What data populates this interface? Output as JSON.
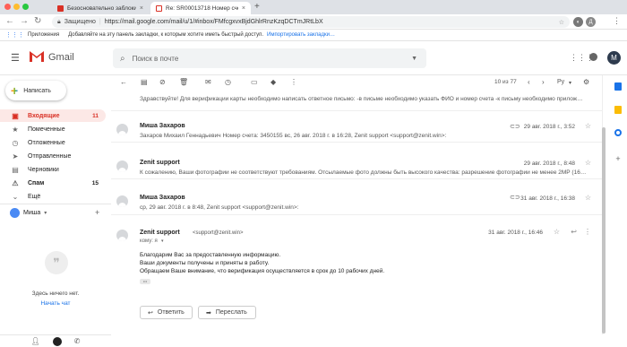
{
  "browser": {
    "tabs": [
      {
        "title": "Безосновательно заблокиров…",
        "close": "×"
      },
      {
        "title": "Re: SR00013718 Номер счета…",
        "close": "×"
      }
    ],
    "new_tab": "+",
    "secure_label": "Защищено",
    "url": "https://mail.google.com/mail/u/1/#inbox/FMfcgxvxBjdGhlrRnzKzqDCTmJRtLbX",
    "bookmarks": {
      "apps_label": "Приложения",
      "hint": "Добавляйте на эту панель закладки, к которым хотите иметь быстрый доступ.",
      "import_link": "Импортировать закладки…"
    },
    "profile_letter": "Д"
  },
  "gmail": {
    "logo_text": "Gmail",
    "search_placeholder": "Поиск в почте",
    "avatar_letter": "M"
  },
  "sidebar": {
    "compose_label": "Написать",
    "items": [
      {
        "label": "Входящие",
        "count": "11",
        "icon": "inbox-icon"
      },
      {
        "label": "Помеченные",
        "count": "",
        "icon": "star-icon"
      },
      {
        "label": "Отложенные",
        "count": "",
        "icon": "clock-icon"
      },
      {
        "label": "Отправленные",
        "count": "",
        "icon": "send-icon"
      },
      {
        "label": "Черновики",
        "count": "",
        "icon": "draft-icon"
      },
      {
        "label": "Спам",
        "count": "15",
        "icon": "spam-icon"
      },
      {
        "label": "Ещё",
        "count": "",
        "icon": "chevron-down-icon"
      }
    ],
    "hangouts_user": "Миша",
    "no_chats": "Здесь ничего нет.",
    "start_chat": "Начать чат"
  },
  "toolbar": {
    "page_info": "10 из 77",
    "lang": "Ру"
  },
  "messages": [
    {
      "sender": "",
      "snippet": "Здравствуйте! Для верификации карты необходимо написать ответное письмо: -в письме необходимо указать ФИО и номер счета -к письму необходимо прилож…",
      "date": ""
    },
    {
      "sender": "Миша Захаров",
      "snippet": "Захаров Михаил Геннадьевич Номер счета: 3450155 вс, 26 авг. 2018 г. в 16:28, Zenit support <support@zenit.win>:",
      "date": "29 авг. 2018 г., 3:52"
    },
    {
      "sender": "Zenit support",
      "snippet": "К сожалению, Ваши фотографии не соответствуют требованиям. Отсылаемые фото должны быть высокого качества: разрешение фотографии не менее 2МР (16…",
      "date": "29 авг. 2018 г., 8:48"
    },
    {
      "sender": "Миша Захаров",
      "snippet": "ср, 29 авг. 2018 г. в 8:48, Zenit support <support@zenit.win>:",
      "date": "31 авг. 2018 г., 16:38"
    }
  ],
  "open_message": {
    "sender": "Zenit support",
    "email": "<support@zenit.win>",
    "to": "кому: я",
    "date": "31 авг. 2018 г., 16:46",
    "body": [
      "Благодарим Вас за предоставленную информацию.",
      "Ваши документы получены и приняты в работу.",
      "Обращаем Ваше внимание, что верификация осуществляется в срок до 10 рабочих дней."
    ],
    "ellipsis": "•••",
    "reply_label": "Ответить",
    "forward_label": "Переслать"
  }
}
